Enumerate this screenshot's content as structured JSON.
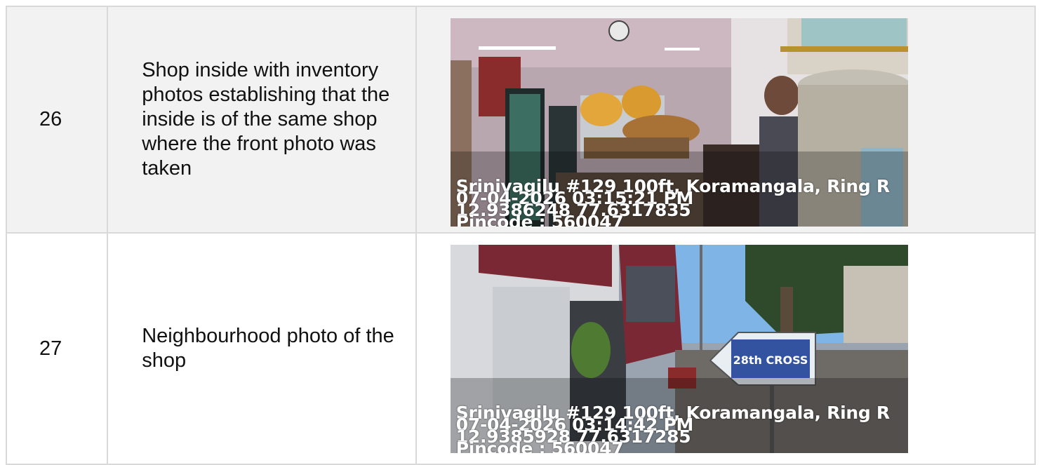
{
  "rows": [
    {
      "number": "26",
      "description": "Shop inside with inventory photos establishing that the inside is of the same shop where the front photo was taken",
      "photo": {
        "subject": "shop interior with snacks counter",
        "stamp": {
          "address": "Srinivagilu #129 100ft, Koramangala, Ring R",
          "datetime": "07-04-2026 03:15:21 PM",
          "coords": "12.9386248 77.6317835",
          "pincode": "Pincode : 560047"
        }
      }
    },
    {
      "number": "27",
      "description": "Neighbourhood photo of the shop",
      "photo": {
        "subject": "street view with 28th cross sign",
        "sign_text": "28th CROSS",
        "stamp": {
          "address": "Srinivagilu #129 100ft, Koramangala, Ring R",
          "datetime": "07-04-2026 03:14:42 PM",
          "coords": "12.9385928 77.6317285",
          "pincode": "Pincode : 560047"
        }
      }
    }
  ]
}
